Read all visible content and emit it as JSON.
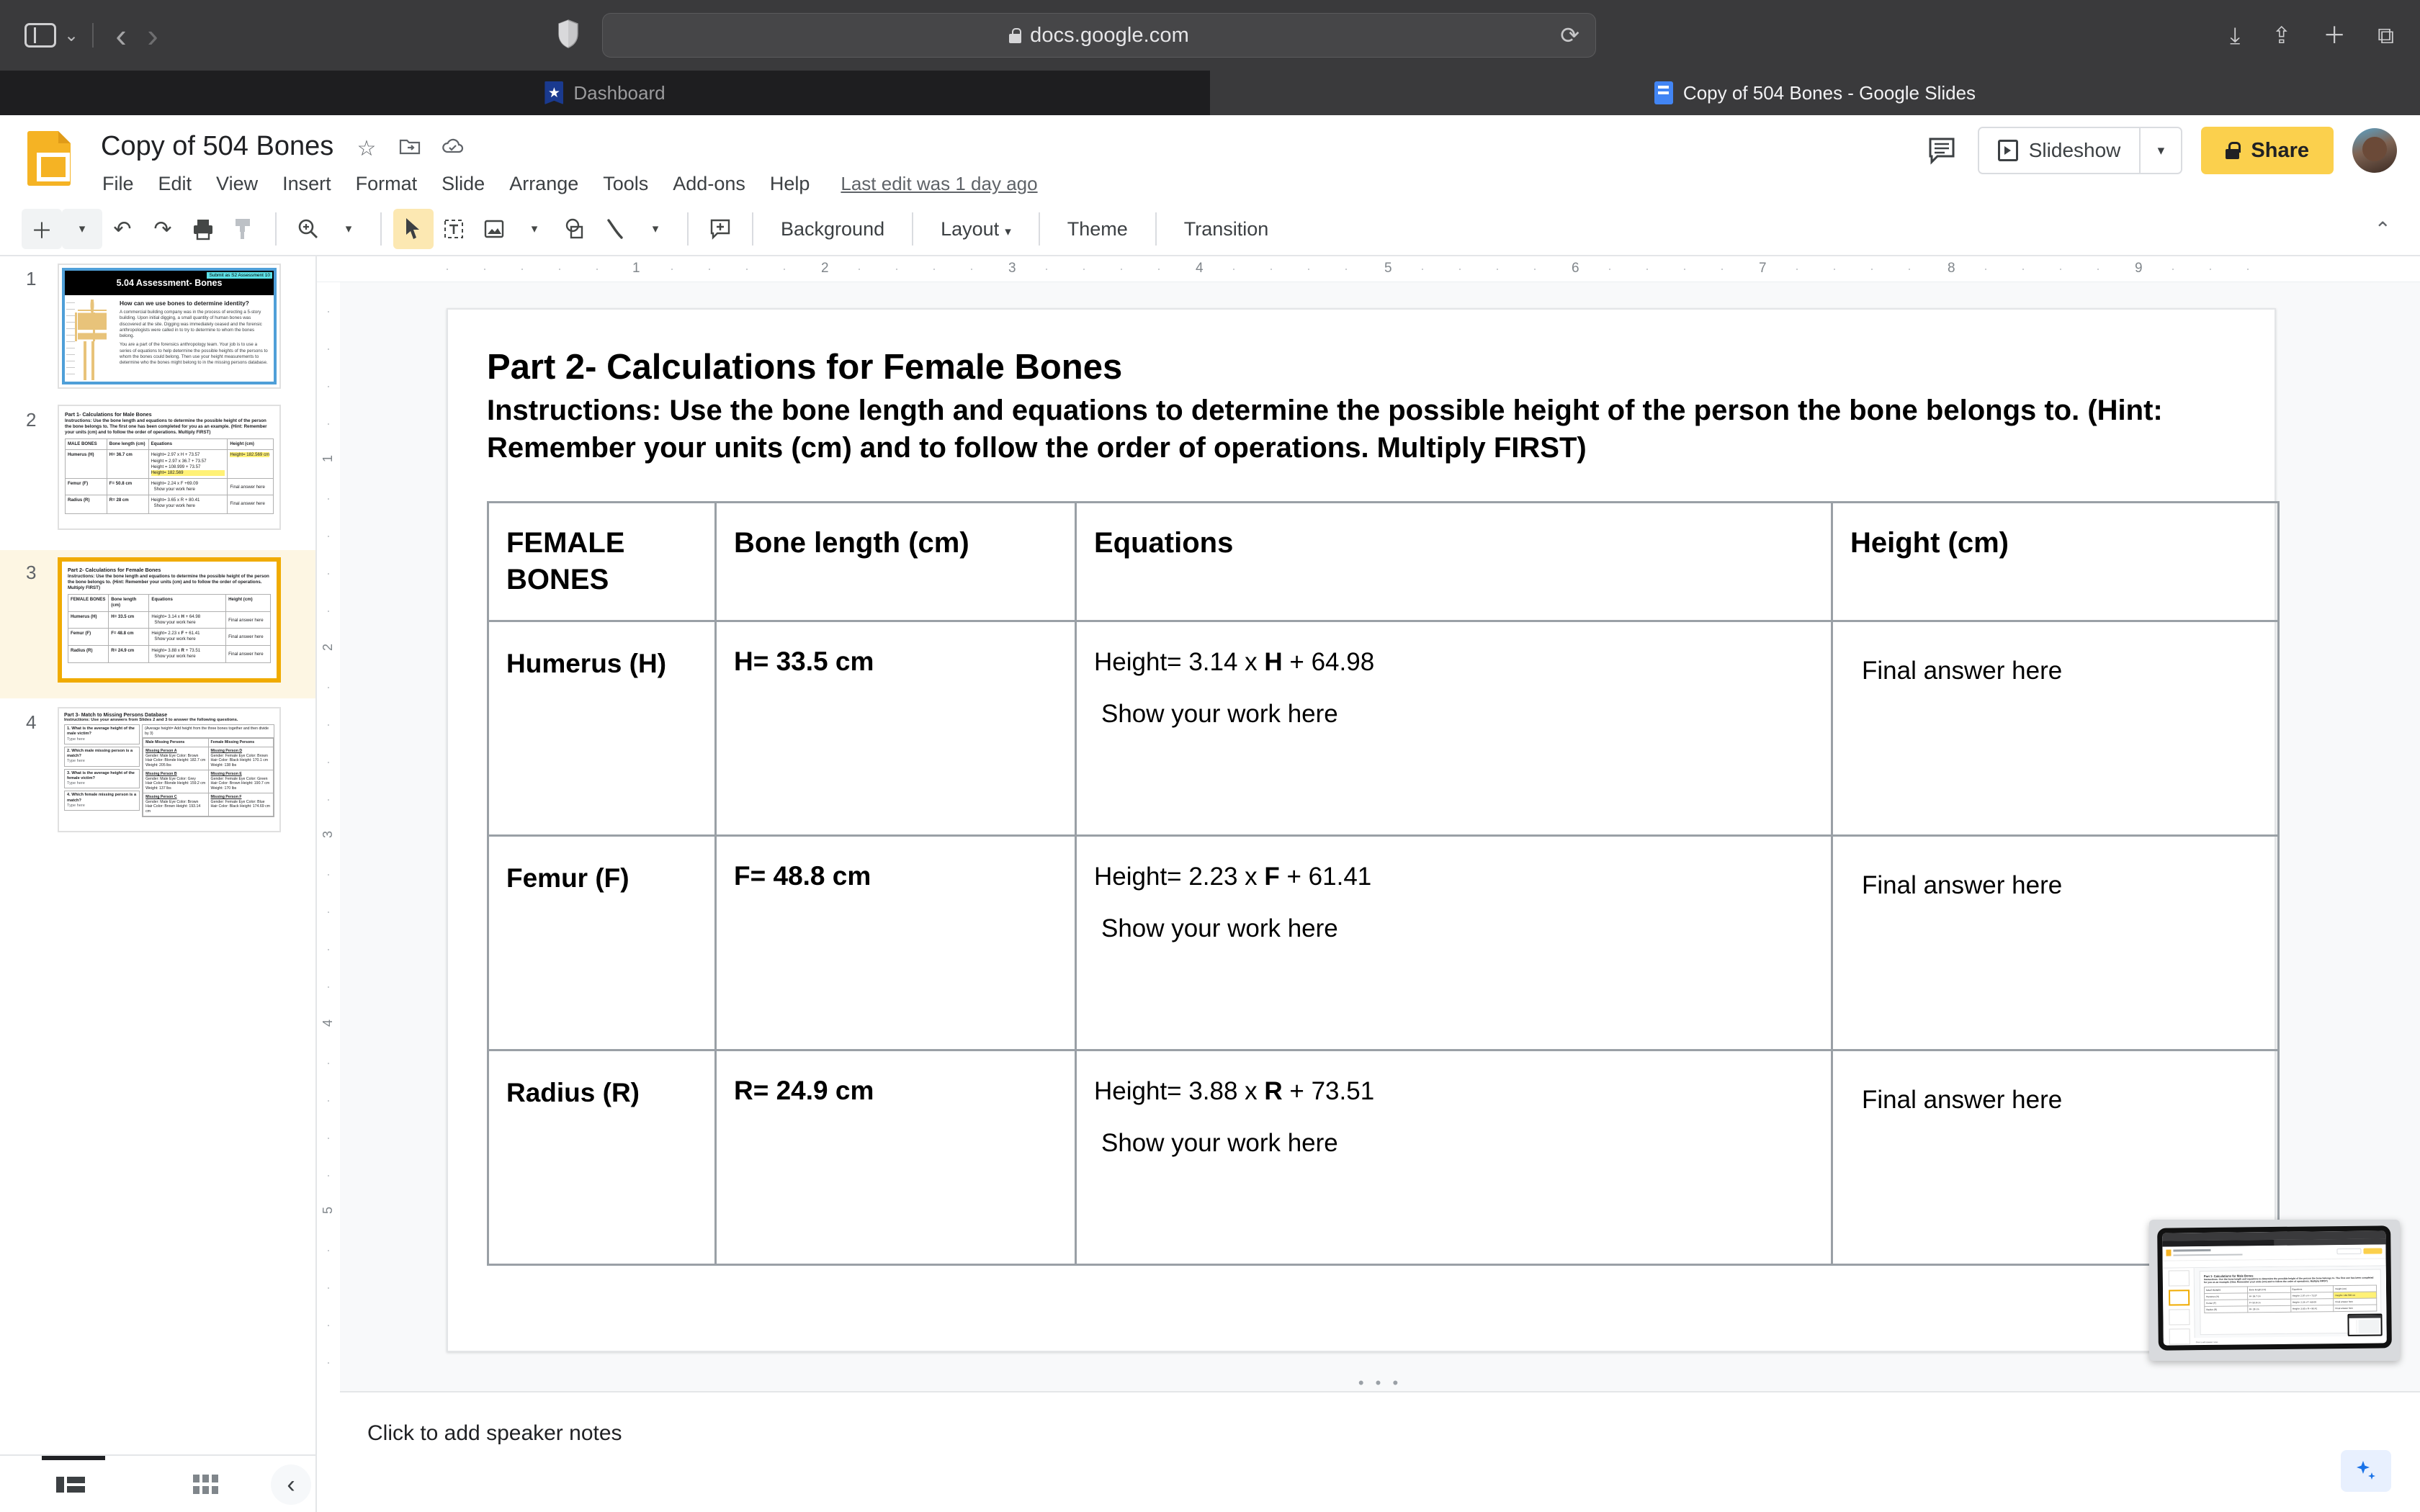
{
  "browser": {
    "url": "docs.google.com",
    "lock_icon": "lock-icon",
    "shield_icon": "shield-icon",
    "reload_icon": "reload-icon",
    "back_icon": "chevron-left-icon",
    "forward_icon": "chevron-right-icon",
    "sidebar_icon": "sidebar-toggle-icon",
    "download_icon": "download-icon",
    "share_icon": "share-icon",
    "new_tab_icon": "plus-icon",
    "tabs_overview_icon": "tab-overview-icon",
    "tabs": [
      {
        "title": "Dashboard",
        "favicon": "dashboard-favicon",
        "active": false
      },
      {
        "title": "Copy of 504 Bones - Google Slides",
        "favicon": "google-slides-favicon",
        "active": true
      }
    ]
  },
  "slides_app": {
    "doc_title": "Copy of 504 Bones",
    "title_icons": [
      "star-icon",
      "move-to-folder-icon",
      "cloud-saved-icon"
    ],
    "menus": [
      "File",
      "Edit",
      "View",
      "Insert",
      "Format",
      "Slide",
      "Arrange",
      "Tools",
      "Add-ons",
      "Help"
    ],
    "last_edit": "Last edit was 1 day ago",
    "comment_icon": "comment-history-icon",
    "slideshow_label": "Slideshow",
    "slideshow_icon": "present-icon",
    "slideshow_caret": "▾",
    "share_label": "Share",
    "share_icon": "lock-icon",
    "avatar": "user-avatar",
    "collapse_caret": "⌃"
  },
  "toolbar": {
    "new_slide_icon": "plus-icon",
    "new_slide_caret": "▾",
    "undo_icon": "undo-icon",
    "redo_icon": "redo-icon",
    "print_icon": "print-icon",
    "paint_format_icon": "paint-format-icon",
    "zoom_icon": "zoom-icon",
    "zoom_caret": "▾",
    "select_icon": "cursor-select-icon",
    "textbox_icon": "text-box-icon",
    "image_icon": "image-icon",
    "image_caret": "▾",
    "shape_icon": "shape-icon",
    "line_icon": "line-icon",
    "line_caret": "▾",
    "comment_icon": "add-comment-icon",
    "background_label": "Background",
    "layout_label": "Layout",
    "layout_caret": "▾",
    "theme_label": "Theme",
    "transition_label": "Transition"
  },
  "filmstrip": {
    "slides": [
      {
        "number": "1",
        "selected": false
      },
      {
        "number": "2",
        "selected": false
      },
      {
        "number": "3",
        "selected": true
      },
      {
        "number": "4",
        "selected": false
      }
    ],
    "slide1": {
      "banner_title": "5.04 Assessment- Bones",
      "tag": "Submit as S2 Assessment 10",
      "heading": "How can we use bones to determine identity?",
      "para1": "A commercial building company was in the process of erecting a 5-story building. Upon initial digging, a small quantity of human bones was discovered at the site. Digging was immediately ceased and the forensic anthropologists were called in to try to determine to whom the bones belong.",
      "para2": "You are a part of the forensics anthropology team. Your job is to use a series of equations to help determine the possible heights of the persons to whom the bones could belong. Then use your height measurements to determine who the bones might belong to in the missing persons database."
    },
    "slide2": {
      "title": "Part 1- Calculations for Male Bones",
      "instructions": "Instructions: Use the bone length and equations to determine the possible height of the person the bone belongs to. The first one has been completed for you as an example. (Hint: Remember your units (cm) and to follow the order of operations. Multiply FIRST)",
      "headers": [
        "MALE BONES",
        "Bone length (cm)",
        "Equations",
        "Height (cm)"
      ],
      "rows": [
        {
          "bone": "Humerus (H)",
          "length": "H= 36.7 cm",
          "equation_lines": [
            "Height= 2.97 x H + 73.57",
            "Height = 2.97 x 36.7 + 73.57",
            "Height = 108.999 + 73.57",
            "Height= 182.569"
          ],
          "height": "Height= 182.569 cm"
        },
        {
          "bone": "Femur (F)",
          "length": "F= 50.8 cm",
          "equation_lines": [
            "Height= 2.24 x F +69.09",
            "Show your work here"
          ],
          "height": "Final answer here"
        },
        {
          "bone": "Radius (R)",
          "length": "R= 28 cm",
          "equation_lines": [
            "Height= 3.65 x R + 80.41",
            "Show your work here"
          ],
          "height": "Final answer here"
        }
      ]
    },
    "slide4": {
      "title": "Part 3- Match to Missing Persons Database",
      "instructions": "Instructions: Use your answers from Slides 2 and 3 to answer the following questions.",
      "questions": [
        {
          "q": "1. What is the average height of the male victim?",
          "placeholder": "Type here"
        },
        {
          "q": "2. Which male missing person is a match?",
          "placeholder": "Type here"
        },
        {
          "q": "3. What is the average height of the female victim?",
          "placeholder": "Type here"
        },
        {
          "q": "4. Which female missing person is a match?",
          "placeholder": "Type here"
        }
      ],
      "note": "(Average height= Add height from the three bones together and then divide by 3)",
      "db_headers": [
        "Male Missing Persons",
        "Female Missing Persons"
      ],
      "db_rows": [
        {
          "male": "Missing Person A|Gender: Male   Eye Color: Brown|Hair Color: Blonde   Height: 182.7 cm|Weight: 205 lbs",
          "female": "Missing Person D|Gender: Female   Eye Color: Brown|Hair Color: Black   Height: 170.1 cm|Weight: 138 lbs"
        },
        {
          "male": "Missing Person B|Gender: Male   Eye Color: Grey|Hair Color: Blonde   Height: 159.2 cm|Weight: 137 lbs",
          "female": "Missing Person E|Gender: Female   Eye Color: Green|Hair Color: Brown   Height: 190.7 cm|Weight: 170 lbs"
        },
        {
          "male": "Missing Person C|Gender: Male   Eye Color: Brown|Hair Color: Brown   Height: 193.14 cm",
          "female": "Missing Person F|Gender: Female   Eye Color: Blue|Hair Color: Black   Height: 174.69 cm"
        }
      ]
    },
    "bottom": {
      "filmstrip_view_icon": "filmstrip-view-icon",
      "grid_view_icon": "grid-view-icon",
      "collapse_icon": "chevron-left-icon"
    }
  },
  "ruler": {
    "h_ticks": [
      "1",
      "2",
      "3",
      "4",
      "5",
      "6",
      "7",
      "8",
      "9"
    ],
    "v_ticks": [
      "1",
      "2",
      "3",
      "4",
      "5"
    ]
  },
  "slide": {
    "title": "Part 2- Calculations for Female Bones",
    "instructions": "Instructions: Use the bone length and equations to determine the possible height of the person the bone belongs to. (Hint: Remember your units (cm) and to follow the order of operations. Multiply FIRST)",
    "table": {
      "headers": [
        "FEMALE BONES",
        "Bone length (cm)",
        "Equations",
        "Height (cm)"
      ],
      "rows": [
        {
          "bone": "Humerus (H)",
          "length": "H= 33.5 cm",
          "equation_prefix": "Height= 3.14 x ",
          "equation_var": "H",
          "equation_suffix": " + 64.98",
          "work": "Show your work here",
          "height": "Final answer here"
        },
        {
          "bone": "Femur (F)",
          "length": "F= 48.8 cm",
          "equation_prefix": "Height= 2.23 x ",
          "equation_var": "F",
          "equation_suffix": " + 61.41",
          "work": "Show your work here",
          "height": "Final answer here"
        },
        {
          "bone": "Radius (R)",
          "length": "R= 24.9 cm",
          "equation_prefix": "Height= 3.88 x ",
          "equation_var": "R",
          "equation_suffix": " + 73.51",
          "work": "Show your work here",
          "height": "Final answer here"
        }
      ]
    },
    "drag_dots": "• • •"
  },
  "notes": {
    "placeholder": "Click to add speaker notes",
    "explore_icon": "explore-sparkle-icon"
  },
  "pip": {
    "label": "screen-share-preview",
    "slide_title": "Part 1- Calculations for Male Bones",
    "slide_instructions": "Instructions: Use the bone length and equations to determine the possible height of the person the bone belongs to. The first one has been completed for you as an example. (Hint: Remember your units (cm) and to follow the order of operations. Multiply FIRST)",
    "headers": [
      "MALE BONES",
      "Bone length (cm)",
      "Equations",
      "Height (cm)"
    ],
    "rows": [
      {
        "bone": "Humerus (H)",
        "length": "H= 36.7 cm",
        "equation": "Height= 2.97 x H + 73.57",
        "height": "Height= 182.569 cm"
      },
      {
        "bone": "Femur (F)",
        "length": "F= 50.8 cm",
        "equation": "Height= 2.24 x F +69.09",
        "height": "Final answer here"
      },
      {
        "bone": "Radius (R)",
        "length": "R= 28 cm",
        "equation": "Height= 3.65 x R + 80.41",
        "height": "Final answer here"
      }
    ],
    "notes": "Click to add speaker notes"
  },
  "colors": {
    "accent_yellow": "#fbd04d",
    "selected_ring": "#f0ab00",
    "chrome_bg": "#3a3a3c",
    "tab_inactive": "#1e1e20",
    "canvas_bg": "#f8f9fa",
    "highlight": "#fff176"
  }
}
